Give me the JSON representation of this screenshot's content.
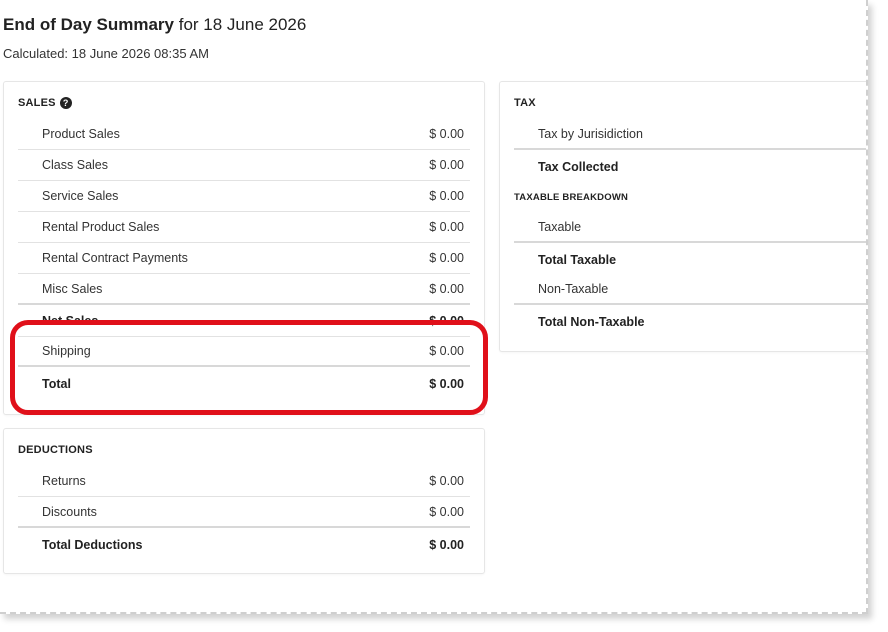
{
  "header": {
    "title": "End of Day Summary",
    "title_suffix": " for 18 June 2026",
    "calculated": "Calculated: 18 June 2026 08:35 AM"
  },
  "sales": {
    "heading": "SALES",
    "help_glyph": "?",
    "rows": [
      {
        "label": "Product Sales",
        "amount": "$ 0.00"
      },
      {
        "label": "Class Sales",
        "amount": "$ 0.00"
      },
      {
        "label": "Service Sales",
        "amount": "$ 0.00"
      },
      {
        "label": "Rental Product Sales",
        "amount": "$ 0.00"
      },
      {
        "label": "Rental Contract Payments",
        "amount": "$ 0.00"
      },
      {
        "label": "Misc Sales",
        "amount": "$ 0.00"
      },
      {
        "label": "Net Sales",
        "amount": "$ 0.00"
      },
      {
        "label": "Shipping",
        "amount": "$ 0.00"
      },
      {
        "label": "Total",
        "amount": "$ 0.00"
      }
    ]
  },
  "deductions": {
    "heading": "DEDUCTIONS",
    "rows": [
      {
        "label": "Returns",
        "amount": "$ 0.00"
      },
      {
        "label": "Discounts",
        "amount": "$ 0.00"
      },
      {
        "label": "Total Deductions",
        "amount": "$ 0.00"
      }
    ]
  },
  "tax": {
    "heading": "TAX",
    "rows": [
      {
        "label": "Tax by Jurisidiction"
      },
      {
        "label": "Tax Collected"
      }
    ],
    "breakdown_heading": "TAXABLE BREAKDOWN",
    "breakdown_rows": [
      {
        "label": "Taxable"
      },
      {
        "label": "Total Taxable"
      },
      {
        "label": "Non-Taxable"
      },
      {
        "label": "Total Non-Taxable"
      }
    ]
  },
  "annotation": {
    "color": "#e0101a"
  }
}
